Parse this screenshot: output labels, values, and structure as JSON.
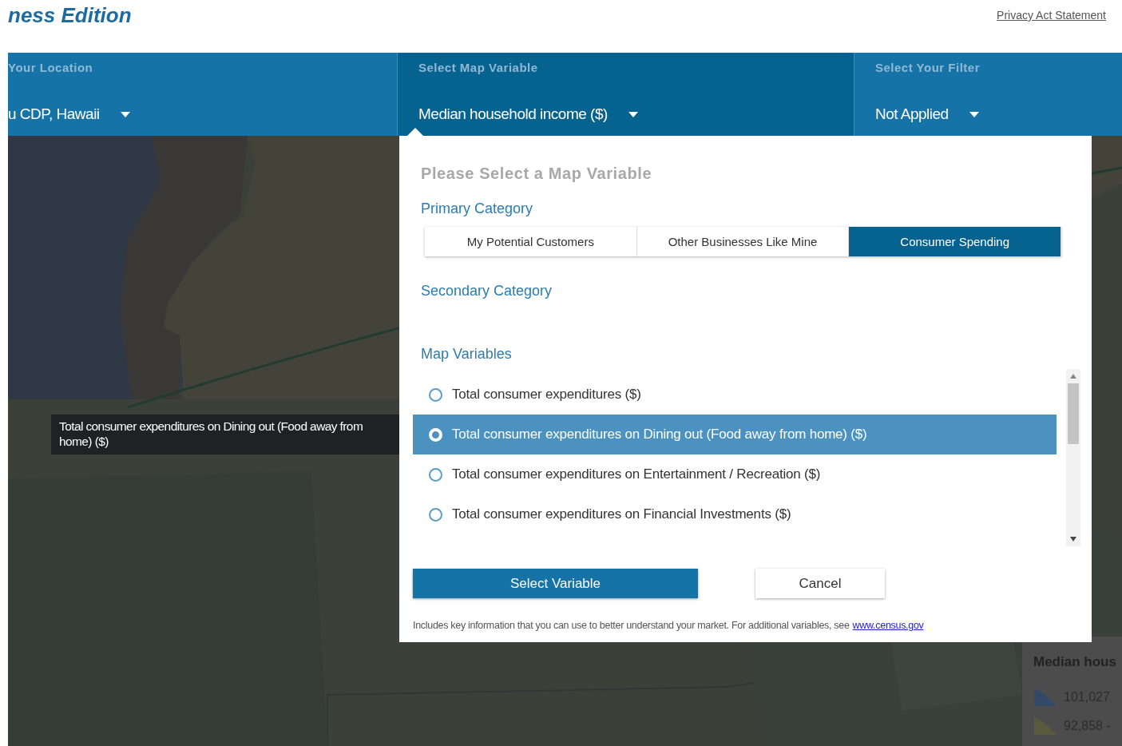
{
  "header": {
    "title": "ness Edition",
    "link": "Privacy Act Statement"
  },
  "selectors": [
    {
      "label": "Your Location",
      "value": "u CDP, Hawaii",
      "selected": false
    },
    {
      "label": "Select Map Variable",
      "value": "Median household income ($)",
      "selected": true
    },
    {
      "label": "Select Your Filter",
      "value": "Not Applied",
      "selected": false
    }
  ],
  "map": {
    "kind": "picture",
    "legend": {
      "title": "Median hous",
      "items": [
        {
          "label": "101,027",
          "color": "#344868"
        },
        {
          "label": "92,858 -",
          "color": "#5a5a3c"
        }
      ]
    }
  },
  "tooltip": "Total consumer expenditures on Dining out (Food away from home) ($)",
  "dialog": {
    "title": "Please Select a Map Variable",
    "primary_heading": "Primary Category",
    "tabs": [
      {
        "label": "My Potential Customers",
        "selected": false
      },
      {
        "label": "Other Businesses Like Mine",
        "selected": false
      },
      {
        "label": "Consumer Spending",
        "selected": true
      }
    ],
    "secondary_heading": "Secondary Category",
    "variables_heading": "Map Variables",
    "variables": [
      {
        "label": "Total consumer expenditures ($)",
        "selected": false
      },
      {
        "label": "Total consumer expenditures on Dining out (Food away from home) ($)",
        "selected": true
      },
      {
        "label": "Total consumer expenditures on Entertainment / Recreation ($)",
        "selected": false
      },
      {
        "label": "Total consumer expenditures on Financial Investments ($)",
        "selected": false
      }
    ],
    "buttons": [
      {
        "label": "Select Variable",
        "kind": "primary"
      },
      {
        "label": "Cancel",
        "kind": "secondary"
      }
    ],
    "footnote": "Includes key information that you can use to better understand your market. For additional variables, see",
    "footnote_link": "www.census.gov"
  }
}
